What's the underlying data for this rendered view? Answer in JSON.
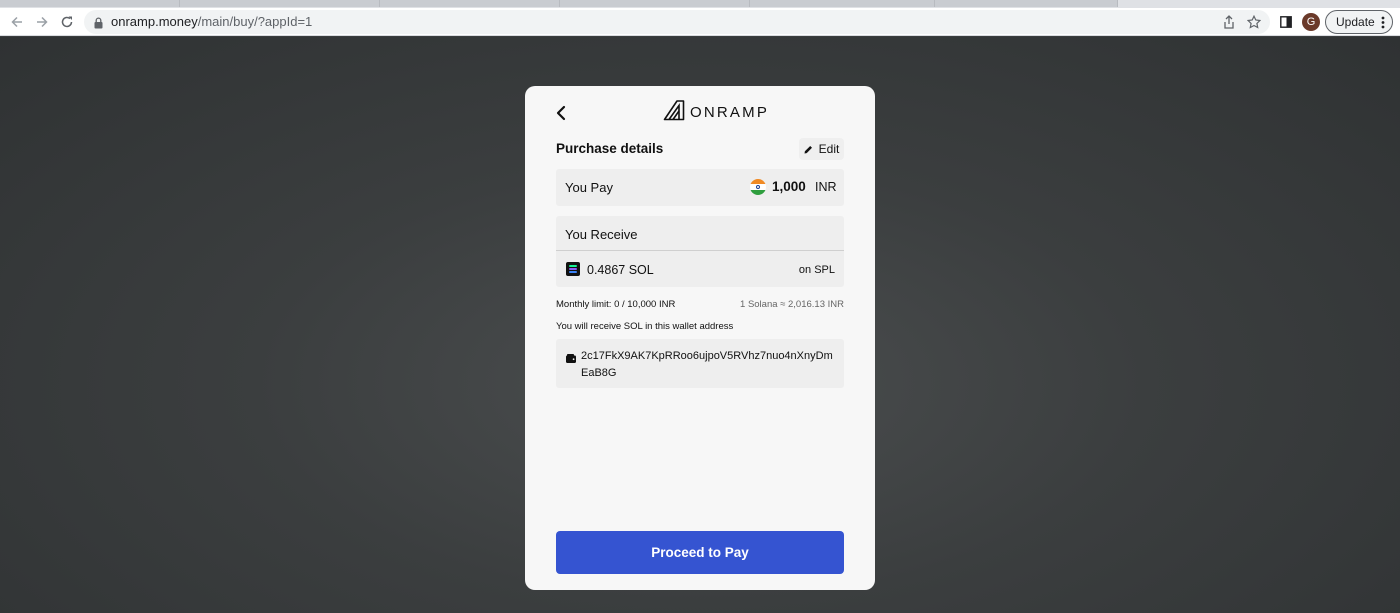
{
  "browser": {
    "url_host": "onramp.money",
    "url_path": "/main/buy/?appId=1",
    "avatar_letter": "G",
    "update_label": "Update"
  },
  "widget": {
    "logo_text": "ONRAMP",
    "section_title": "Purchase details",
    "edit_label": "Edit",
    "pay": {
      "label": "You Pay",
      "amount": "1,000",
      "currency": "INR"
    },
    "receive": {
      "label": "You Receive",
      "amount": "0.4867  SOL",
      "network": "on SPL"
    },
    "monthly_limit": "Monthly limit: 0 / 10,000 INR",
    "rate": "1 Solana ≈ 2,016.13 INR",
    "wallet_caption": "You will receive SOL in this wallet address",
    "wallet_address": "2c17FkX9AK7KpRRoo6ujpoV5RVhz7nuo4nXnyDmEaB8G",
    "proceed_label": "Proceed to Pay"
  },
  "colors": {
    "accent": "#3554d1",
    "card_bg": "#f7f7f7",
    "row_bg": "#eeeeee",
    "page_bg": "#3a3d3e"
  },
  "icons": [
    "back-arrow-icon",
    "forward-arrow-icon",
    "reload-icon",
    "lock-icon",
    "share-icon",
    "bookmark-star-icon",
    "side-panel-icon",
    "menu-dots-icon",
    "chevron-left-icon",
    "onramp-logo-icon",
    "pencil-icon",
    "india-flag-icon",
    "solana-icon",
    "wallet-icon"
  ]
}
